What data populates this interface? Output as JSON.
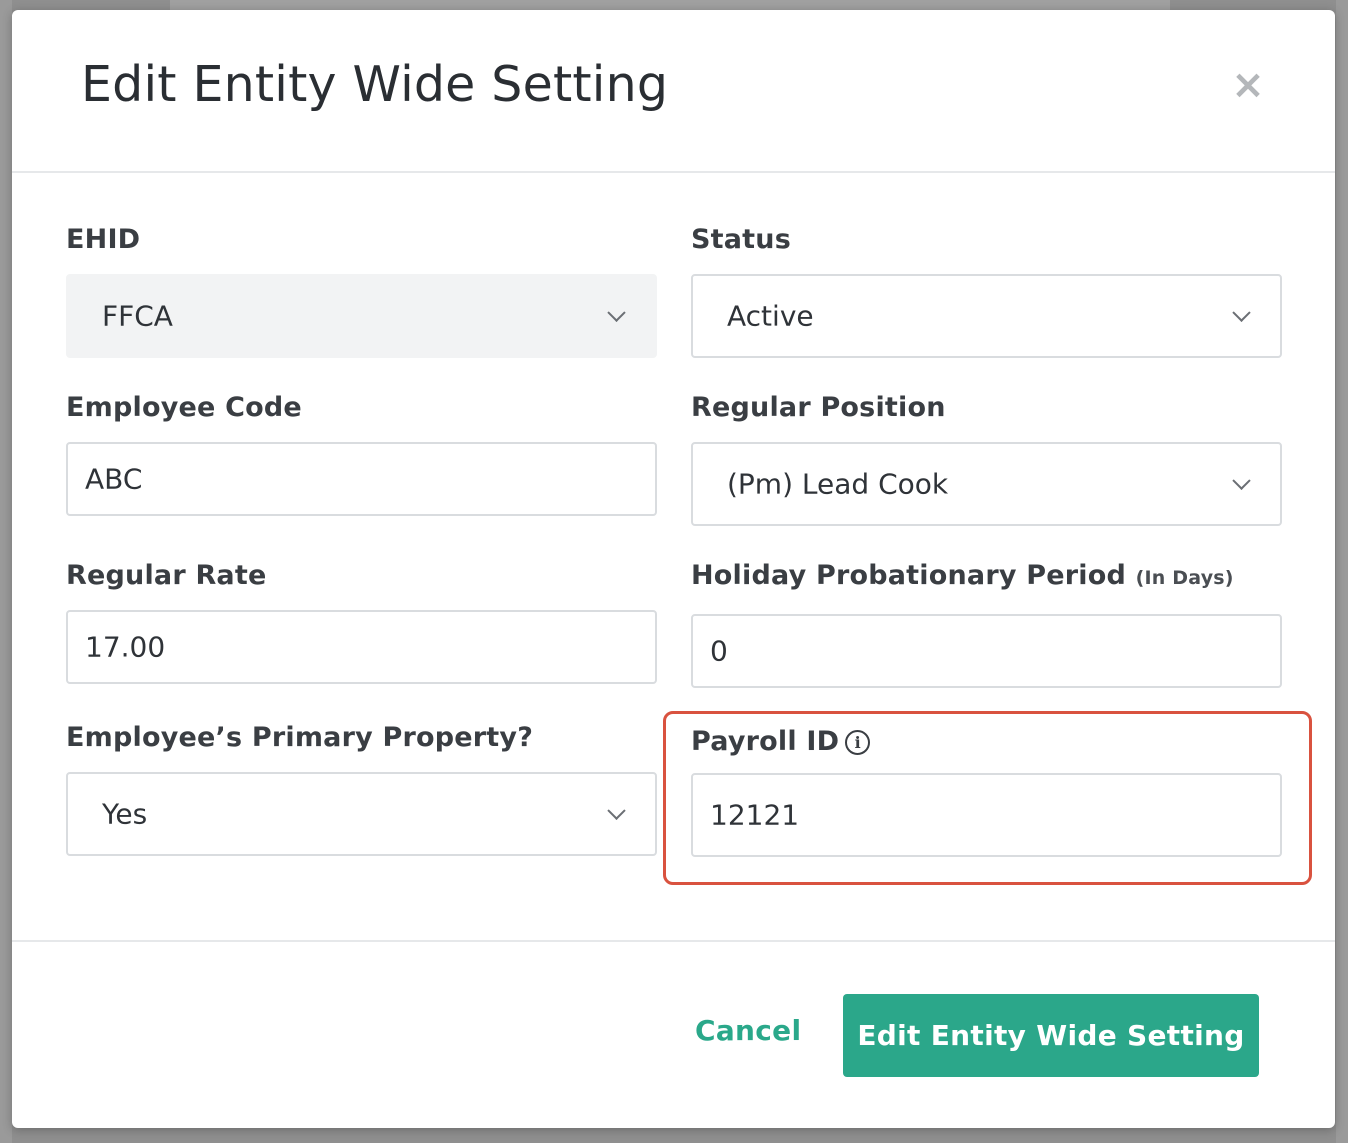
{
  "modal": {
    "title": "Edit Entity Wide Setting",
    "close_icon": "×"
  },
  "fields": {
    "ehid": {
      "label": "EHID",
      "value": "FFCA",
      "type": "select",
      "disabled": true
    },
    "status": {
      "label": "Status",
      "value": "Active",
      "type": "select"
    },
    "employee_code": {
      "label": "Employee Code",
      "value": "ABC",
      "type": "text"
    },
    "regular_position": {
      "label": "Regular Position",
      "value": "(Pm) Lead Cook",
      "type": "select"
    },
    "regular_rate": {
      "label": "Regular Rate",
      "value": "17.00",
      "type": "text"
    },
    "holiday_probationary_period": {
      "label": "Holiday Probationary Period",
      "label_suffix": "(In Days)",
      "value": "0",
      "type": "text"
    },
    "primary_property": {
      "label": "Employee’s Primary Property?",
      "value": "Yes",
      "type": "select"
    },
    "payroll_id": {
      "label": "Payroll ID",
      "info_icon": "i",
      "value": "12121",
      "type": "text"
    }
  },
  "footer": {
    "cancel_label": "Cancel",
    "submit_label": "Edit Entity Wide Setting"
  },
  "colors": {
    "accent": "#2ba78a",
    "highlight": "#d9523f"
  }
}
